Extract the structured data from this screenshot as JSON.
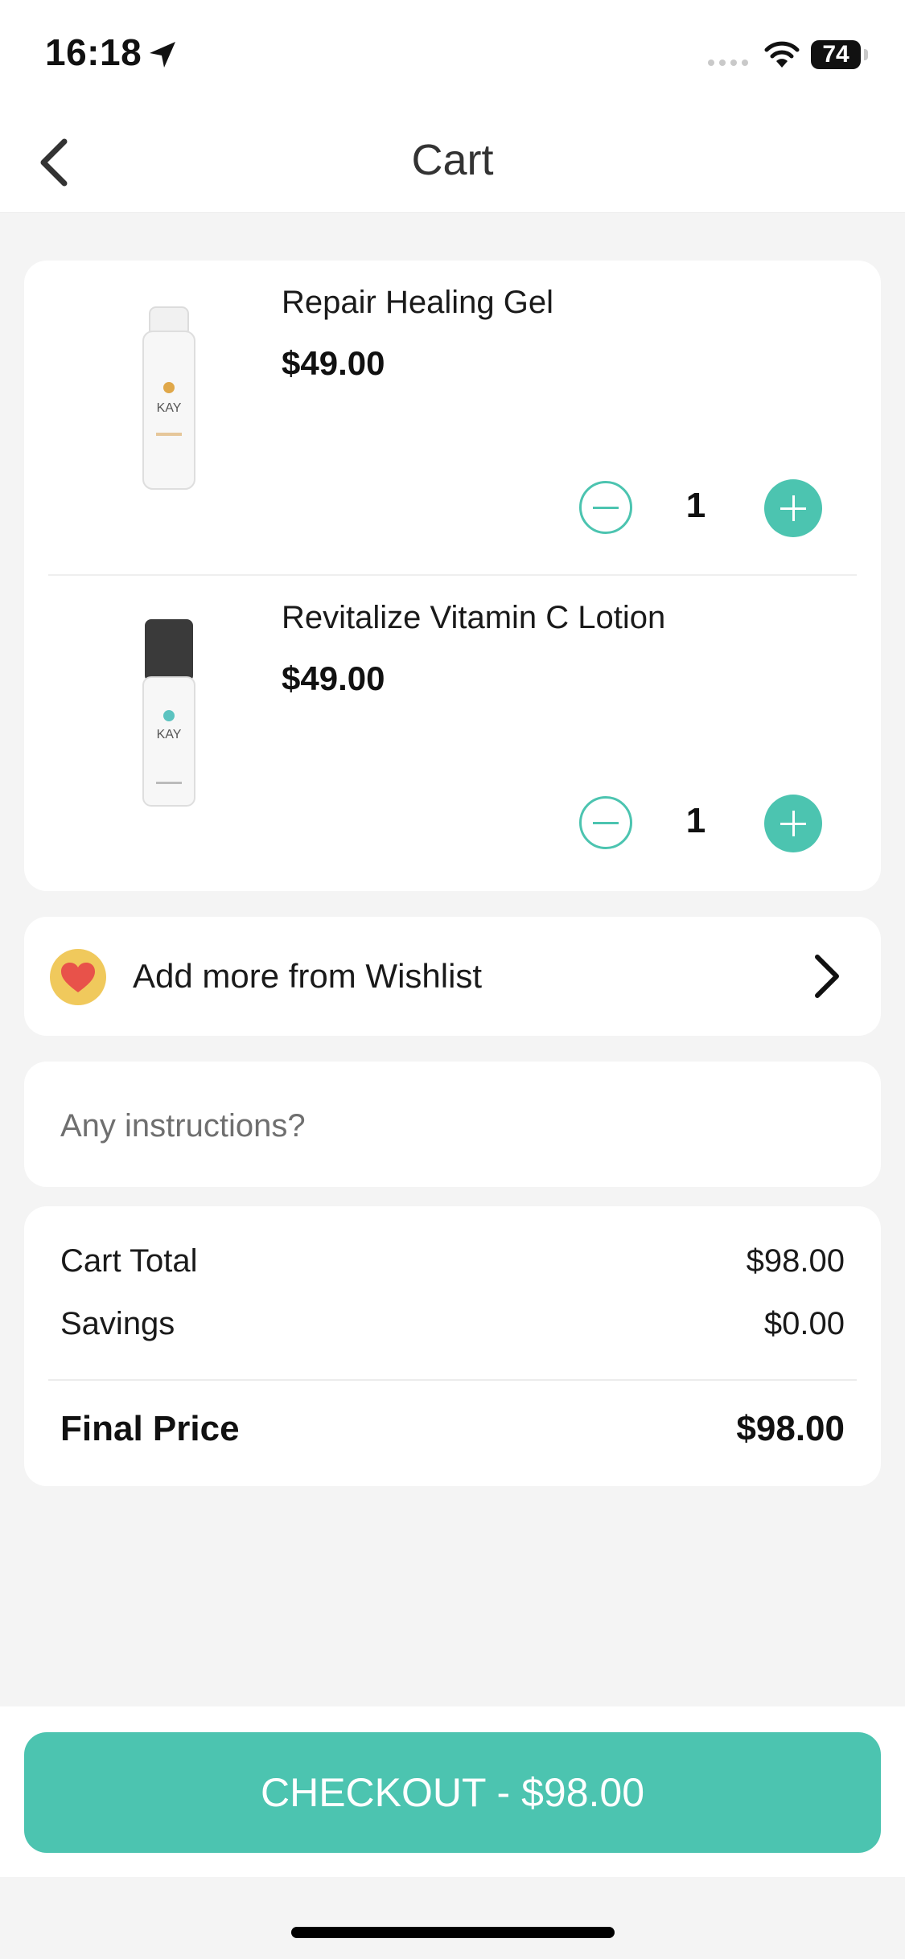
{
  "status_bar": {
    "time": "16:18",
    "battery": "74"
  },
  "header": {
    "title": "Cart"
  },
  "cart": {
    "items": [
      {
        "name": "Repair Healing Gel",
        "price": "$49.00",
        "quantity": "1",
        "image_label": "KAY"
      },
      {
        "name": "Revitalize Vitamin C Lotion",
        "price": "$49.00",
        "quantity": "1",
        "image_label": "KAY"
      }
    ]
  },
  "wishlist": {
    "label": "Add more from Wishlist"
  },
  "instructions": {
    "placeholder": "Any instructions?"
  },
  "summary": {
    "cart_total_label": "Cart Total",
    "cart_total_value": "$98.00",
    "savings_label": "Savings",
    "savings_value": "$0.00",
    "final_label": "Final Price",
    "final_value": "$98.00"
  },
  "checkout": {
    "label": "CHECKOUT - $98.00"
  },
  "colors": {
    "accent": "#4cc4b0",
    "background": "#f4f4f4",
    "wishlist_badge": "#f0c95c",
    "heart": "#e8524a"
  }
}
